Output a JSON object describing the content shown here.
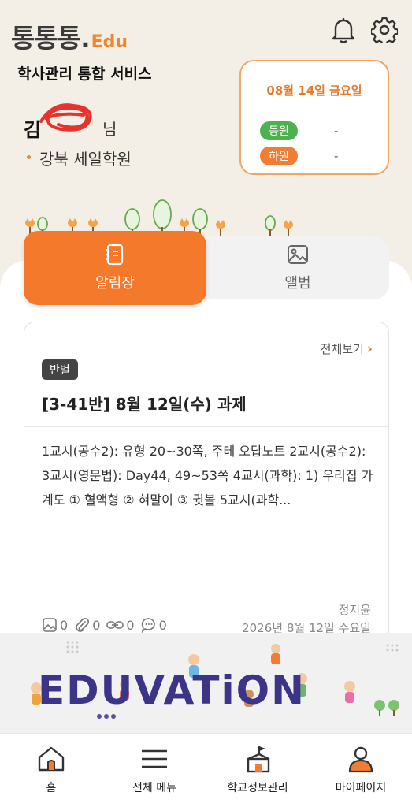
{
  "header": {
    "logo_main": "통통통.",
    "logo_suffix": "Edu",
    "service_title": "학사관리 통합 서비스"
  },
  "user": {
    "name_prefix": "김",
    "name_suffix": "님",
    "academy": "강북 세일학원"
  },
  "attendance": {
    "date": "08월 14일 금요일",
    "check_in_label": "등원",
    "check_in_value": "-",
    "check_out_label": "하원",
    "check_out_value": "-"
  },
  "tabs": [
    {
      "label": "알림장",
      "icon": "notebook-icon",
      "active": true
    },
    {
      "label": "앨범",
      "icon": "photo-icon",
      "active": false
    }
  ],
  "notice": {
    "view_all_label": "전체보기",
    "badge": "반별",
    "title": "[3-41반] 8월 12일(수) 과제",
    "body": "1교시(공수2): 유형 20~30쪽, 주테 오답노트 2교시(공수2): 3교시(영문법): Day44, 49~53쪽 4교시(과학): 1) 우리집 가계도 ① 혈액형 ② 혀말이 ③ 귓볼 5교시(과학...",
    "author": "정지윤",
    "date": "2026년 8월 12일 수요일",
    "stats": {
      "images": "0",
      "attachments": "0",
      "links": "0",
      "comments": "0"
    }
  },
  "banner": {
    "text": "EDUVATiON"
  },
  "bottom_nav": [
    {
      "label": "홈",
      "icon": "home-icon"
    },
    {
      "label": "전체 메뉴",
      "icon": "menu-icon"
    },
    {
      "label": "학교정보관리",
      "icon": "school-icon"
    },
    {
      "label": "마이페이지",
      "icon": "person-icon"
    }
  ],
  "colors": {
    "accent": "#f5792a",
    "check_in": "#4db24d",
    "check_out": "#f07d33",
    "banner_text": "#3c3488"
  }
}
